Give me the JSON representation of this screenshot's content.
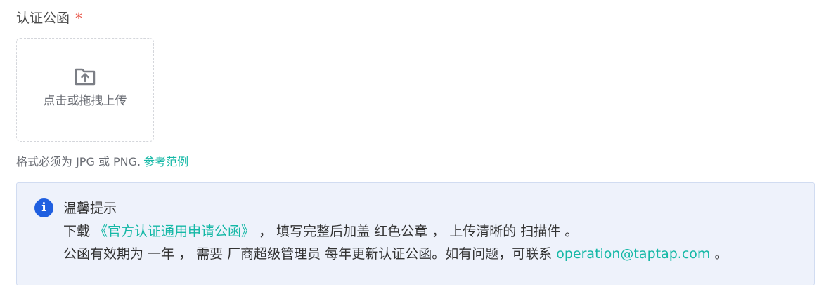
{
  "field": {
    "label": "认证公函",
    "required_mark": "*"
  },
  "upload": {
    "text": "点击或拖拽上传",
    "icon": "upload-folder-icon"
  },
  "hint": {
    "text": "格式必须为 JPG 或 PNG.",
    "link": "参考范例"
  },
  "notice": {
    "icon": "info-icon",
    "icon_glyph": "i",
    "title": "温馨提示",
    "line1_prefix": "下载 ",
    "line1_link": "《官方认证通用申请公函》",
    "line1_suffix": " ， 填写完整后加盖 红色公章 ， 上传清晰的 扫描件 。",
    "line2_prefix": "公函有效期为 一年 ， 需要 厂商超级管理员 每年更新认证公函。如有问题，可联系 ",
    "line2_link": "operation@taptap.com",
    "line2_suffix": " 。"
  },
  "colors": {
    "accent_link": "#15b8a6",
    "required": "#e8574a",
    "info_icon": "#1f5fe0",
    "notice_bg": "#eef2fb",
    "notice_border": "#d1dcf1"
  }
}
